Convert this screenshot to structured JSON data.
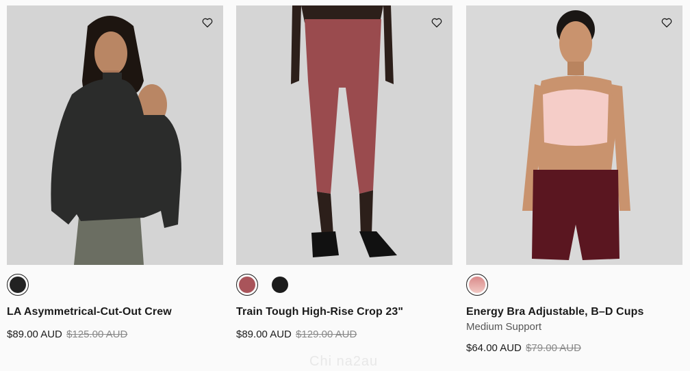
{
  "products": [
    {
      "name": "LA Asymmetrical-Cut-Out Crew",
      "price": "$89.00 AUD",
      "old_price": "$125.00 AUD",
      "image_alt": "Model wearing black asymmetrical cut-out crew sweatshirt",
      "swatches": [
        {
          "color": "#222222",
          "selected": true
        }
      ]
    },
    {
      "name": "Train Tough High-Rise Crop 23\"",
      "price": "$89.00 AUD",
      "old_price": "$129.00 AUD",
      "image_alt": "Model wearing red train tough high-rise crop leggings",
      "swatches": [
        {
          "color": "#a9545a",
          "selected": true
        },
        {
          "color": "#1c1c1c",
          "selected": false
        }
      ]
    },
    {
      "name": "Energy Bra Adjustable, B–D Cups",
      "subtitle": "Medium Support",
      "price": "$64.00 AUD",
      "old_price": "$79.00 AUD",
      "image_alt": "Model wearing light pink energy bra and maroon shorts",
      "swatches": [
        {
          "color": "#e8b8b6",
          "selected": true
        }
      ]
    }
  ],
  "watermark": "Chi na2au"
}
